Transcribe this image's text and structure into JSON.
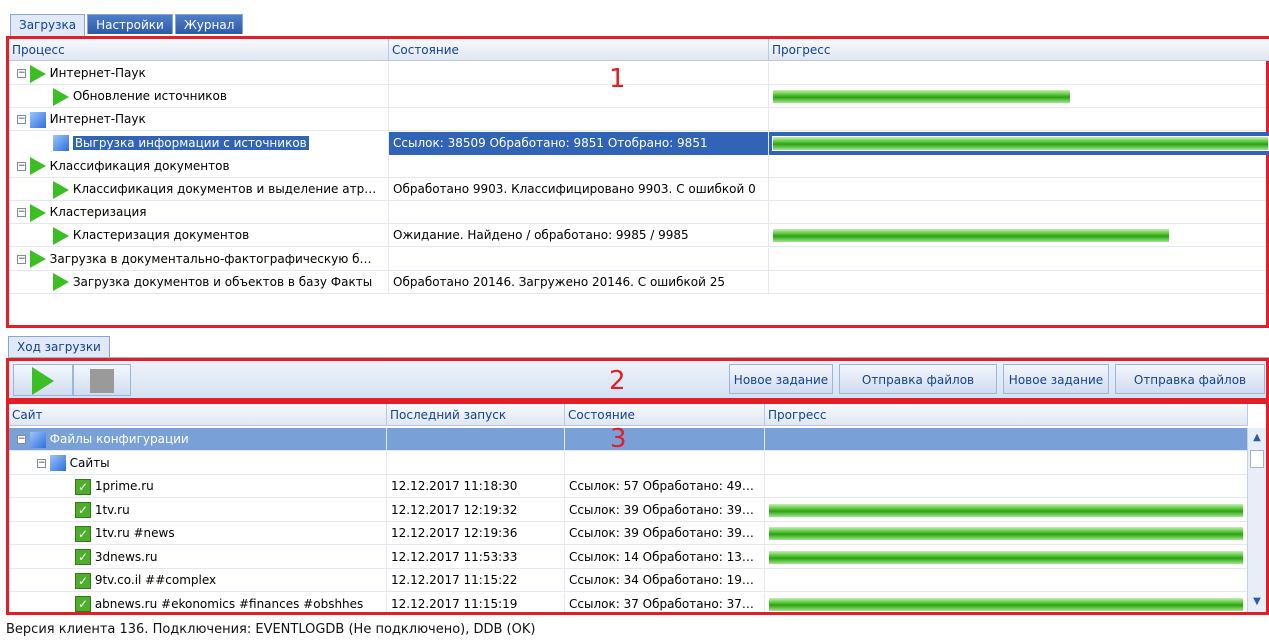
{
  "top_tabs": [
    "Загрузка",
    "Настройки",
    "Журнал"
  ],
  "process_grid": {
    "columns": [
      "Процесс",
      "Состояние",
      "Прогресс"
    ],
    "rows": [
      {
        "level": 0,
        "icon": "play",
        "name": "Интернет-Паук",
        "state": "",
        "progress": null
      },
      {
        "level": 1,
        "icon": "play",
        "name": "Обновление источников",
        "state": "",
        "progress": 0.6
      },
      {
        "level": 0,
        "icon": "square",
        "name": "Интернет-Паук",
        "state": "",
        "progress": null
      },
      {
        "level": 1,
        "icon": "square",
        "name": "Выгрузка информации с источников",
        "state": "Ссылок: 38509 Обработано: 9851 Отобрано: 9851",
        "progress": 1.0,
        "selected": true
      },
      {
        "level": 0,
        "icon": "play",
        "name": "Классификация документов",
        "state": "",
        "progress": null
      },
      {
        "level": 1,
        "icon": "play",
        "name": "Классификация документов и выделение атр…",
        "state": "Обработано 9903. Классифицировано 9903. С ошибкой 0",
        "progress": null
      },
      {
        "level": 0,
        "icon": "play",
        "name": "Кластеризация",
        "state": "",
        "progress": null
      },
      {
        "level": 1,
        "icon": "play",
        "name": "Кластеризация документов",
        "state": "Ожидание. Найдено / обработано: 9985 / 9985",
        "progress": 0.8
      },
      {
        "level": 0,
        "icon": "play",
        "name": "Загрузка в документально-фактографическую б…",
        "state": "",
        "progress": null
      },
      {
        "level": 1,
        "icon": "play",
        "name": "Загрузка документов и объектов в базу Факты",
        "state": "Обработано 20146. Загружено 20146. С ошибкой 25",
        "progress": null
      }
    ]
  },
  "markers": [
    "1",
    "2",
    "3"
  ],
  "lower_tab": "Ход загрузки",
  "toolbar": {
    "buttons": [
      "Новое задание",
      "Отправка файлов",
      "Новое задание",
      "Отправка файлов"
    ]
  },
  "site_grid": {
    "columns": [
      "Сайт",
      "Последний запуск",
      "Состояние",
      "Прогресс"
    ],
    "rows": [
      {
        "level": 0,
        "icon": "square",
        "name": "Файлы конфигурации",
        "last": "",
        "state": "",
        "progress": null,
        "selected": true
      },
      {
        "level": 1,
        "icon": "square",
        "name": "Сайты",
        "last": "",
        "state": "",
        "progress": null
      },
      {
        "level": 2,
        "icon": "check",
        "name": "1prime.ru",
        "last": "12.12.2017 11:18:30",
        "state": "Ссылок: 57 Обработано: 49…",
        "progress": null
      },
      {
        "level": 2,
        "icon": "check",
        "name": "1tv.ru",
        "last": "12.12.2017 12:19:32",
        "state": "Ссылок: 39 Обработано: 39…",
        "progress": 1.0
      },
      {
        "level": 2,
        "icon": "check",
        "name": "1tv.ru #news",
        "last": "12.12.2017 12:19:36",
        "state": "Ссылок: 39 Обработано: 39…",
        "progress": 1.0
      },
      {
        "level": 2,
        "icon": "check",
        "name": "3dnews.ru",
        "last": "12.12.2017 11:53:33",
        "state": "Ссылок: 14 Обработано: 13…",
        "progress": 1.0
      },
      {
        "level": 2,
        "icon": "check",
        "name": "9tv.co.il ##complex",
        "last": "12.12.2017 11:15:22",
        "state": "Ссылок: 34 Обработано: 19…",
        "progress": null
      },
      {
        "level": 2,
        "icon": "check",
        "name": "abnews.ru #ekonomics #finances #obshhes",
        "last": "12.12.2017 11:15:19",
        "state": "Ссылок: 37 Обработано: 37…",
        "progress": 1.0
      }
    ]
  },
  "status_text": "Версия клиента 136. Подключения: EVENTLOGDB (Не подключено), DDB (OK)"
}
